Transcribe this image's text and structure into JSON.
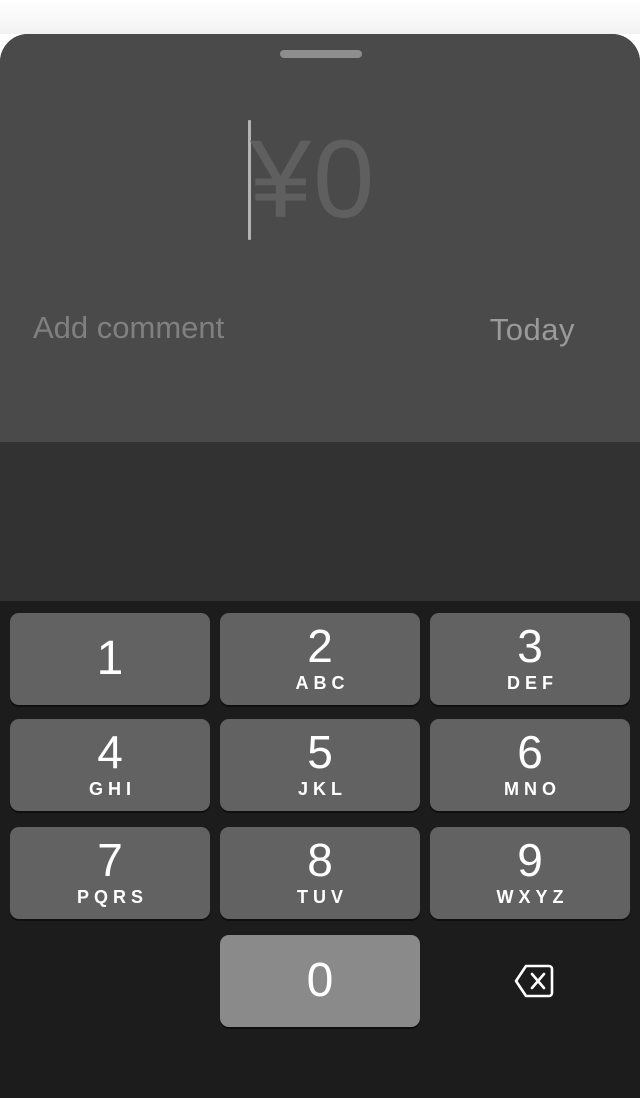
{
  "amount": {
    "display": "¥0"
  },
  "comment": {
    "placeholder": "Add comment"
  },
  "date": {
    "label": "Today"
  },
  "keypad": {
    "keys": [
      {
        "digit": "1",
        "letters": ""
      },
      {
        "digit": "2",
        "letters": "ABC"
      },
      {
        "digit": "3",
        "letters": "DEF"
      },
      {
        "digit": "4",
        "letters": "GHI"
      },
      {
        "digit": "5",
        "letters": "JKL"
      },
      {
        "digit": "6",
        "letters": "MNO"
      },
      {
        "digit": "7",
        "letters": "PQRS"
      },
      {
        "digit": "8",
        "letters": "TUV"
      },
      {
        "digit": "9",
        "letters": "WXYZ"
      },
      {
        "digit": "0",
        "letters": ""
      }
    ],
    "delete_icon": "backspace-icon"
  },
  "colors": {
    "sheet_header": "#4a4a4a",
    "sheet_body": "#323232",
    "keypad_background": "#1c1c1c",
    "key": "#626262",
    "key_pressed": "#8a8a8a"
  }
}
